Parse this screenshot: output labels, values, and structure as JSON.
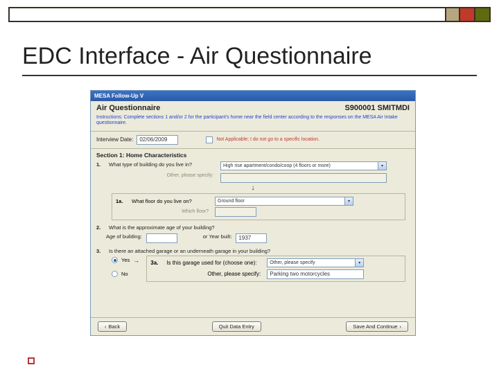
{
  "slide": {
    "title": "EDC Interface - Air Questionnaire"
  },
  "app": {
    "header": "MESA Follow-Up V",
    "form_title": "Air Questionnaire",
    "participant_id": "S900001  SMITMDI",
    "instructions": "Instructions: Complete sections 1 and/or 2 for the participant's home near the field center according to the responses on the MESA Air Intake questionnaire.",
    "interview_date_label": "Interview Date:",
    "interview_date_value": "02/06/2009",
    "na_text": "Not Applicable; I do not go to a specific location.",
    "section1_head": "Section 1: Home Characteristics",
    "q1": {
      "num": "1.",
      "label": "What type of building do you live in?",
      "select_value": "High rise apartment/condo/coop (4 floors or more)",
      "other_label": "Other, please specify:",
      "sub_num": "1a.",
      "sub_label": "What floor do you live on?",
      "sub_select": "Ground floor",
      "sub_floor_label": "Which floor?"
    },
    "q2": {
      "num": "2.",
      "label": "What is the approximate age of your building?",
      "age_label": "Age of building:",
      "or_year_label": "or Year built:",
      "year_value": "1937"
    },
    "q3": {
      "num": "3.",
      "label": "Is there an attached garage or an underneath garage in your building?",
      "yes": "Yes",
      "no": "No",
      "sub_num": "3a.",
      "sub_label": "Is this garage used for (choose one):",
      "sub_select": "Other, please specify",
      "other_label": "Other, please specify:",
      "other_value": "Parking two motorcycles"
    },
    "buttons": {
      "back": "Back",
      "quit": "Quit Data Entry",
      "save": "Save And Continue"
    }
  }
}
